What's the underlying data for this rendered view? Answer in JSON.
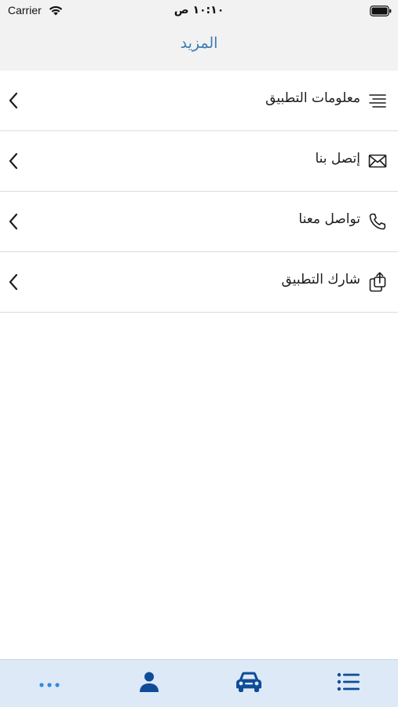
{
  "status_bar": {
    "carrier": "Carrier",
    "time": "١٠:١٠ ص"
  },
  "nav": {
    "title": "المزيد"
  },
  "menu": {
    "items": [
      {
        "label": "معلومات التطبيق",
        "icon": "text-align-icon"
      },
      {
        "label": "إتصل بنا",
        "icon": "envelope-icon"
      },
      {
        "label": "تواصل معنا",
        "icon": "phone-icon"
      },
      {
        "label": "شارك التطبيق",
        "icon": "share-icon"
      }
    ]
  },
  "tab_bar": {
    "tabs": [
      {
        "name": "more",
        "icon": "ellipsis-icon",
        "active": true
      },
      {
        "name": "profile",
        "icon": "person-icon",
        "active": false
      },
      {
        "name": "vehicles",
        "icon": "car-icon",
        "active": false
      },
      {
        "name": "list",
        "icon": "list-icon",
        "active": false
      }
    ]
  },
  "colors": {
    "accent": "#3e7cb1",
    "tab_icon": "#0f4c98",
    "tab_active": "#2f8be6",
    "tab_bar_bg": "#dde9f7"
  }
}
